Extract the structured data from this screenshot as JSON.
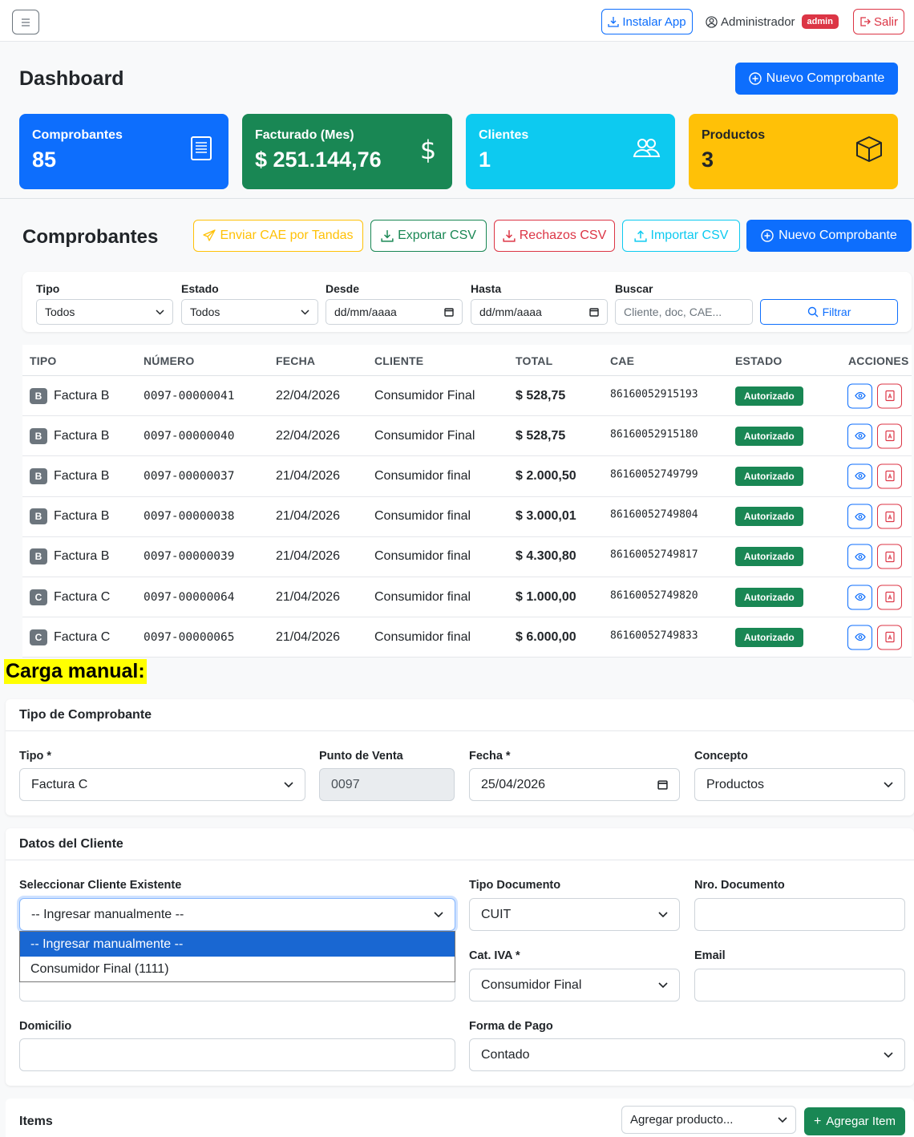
{
  "topbar": {
    "install_label": "Instalar App",
    "user_name": "Administrador",
    "role_badge": "admin",
    "logout_label": "Salir"
  },
  "dashboard": {
    "title": "Dashboard",
    "new_button": "Nuevo Comprobante",
    "stats": [
      {
        "label": "Comprobantes",
        "value": "85",
        "icon": "receipt-icon",
        "color": "#0d6efd"
      },
      {
        "label": "Facturado (Mes)",
        "value": "$ 251.144,76",
        "icon": "dollar-icon",
        "color": "#198754"
      },
      {
        "label": "Clientes",
        "value": "1",
        "icon": "people-icon",
        "color": "#0dcaf0"
      },
      {
        "label": "Productos",
        "value": "3",
        "icon": "box-icon",
        "color": "#ffc107"
      }
    ]
  },
  "comprobantes": {
    "title": "Comprobantes",
    "actions": {
      "send_cae": "Enviar CAE por Tandas",
      "export_csv": "Exportar CSV",
      "rejects_csv": "Rechazos CSV",
      "import_csv": "Importar CSV",
      "new": "Nuevo Comprobante"
    },
    "filters": {
      "tipo_label": "Tipo",
      "tipo_value": "Todos",
      "estado_label": "Estado",
      "estado_value": "Todos",
      "desde_label": "Desde",
      "desde_value": "dd/mm/aaaa",
      "hasta_label": "Hasta",
      "hasta_value": "dd/mm/aaaa",
      "buscar_label": "Buscar",
      "buscar_placeholder": "Cliente, doc, CAE...",
      "filter_button": "Filtrar"
    },
    "columns": [
      "TIPO",
      "NÚMERO",
      "FECHA",
      "CLIENTE",
      "TOTAL",
      "CAE",
      "ESTADO",
      "ACCIONES"
    ],
    "rows": [
      {
        "letter": "B",
        "tipo": "Factura B",
        "numero": "0097-00000041",
        "fecha": "22/04/2026",
        "cliente": "Consumidor Final",
        "total": "$ 528,75",
        "cae": "86160052915193",
        "estado": "Autorizado"
      },
      {
        "letter": "B",
        "tipo": "Factura B",
        "numero": "0097-00000040",
        "fecha": "22/04/2026",
        "cliente": "Consumidor Final",
        "total": "$ 528,75",
        "cae": "86160052915180",
        "estado": "Autorizado"
      },
      {
        "letter": "B",
        "tipo": "Factura B",
        "numero": "0097-00000037",
        "fecha": "21/04/2026",
        "cliente": "Consumidor final",
        "total": "$ 2.000,50",
        "cae": "86160052749799",
        "estado": "Autorizado"
      },
      {
        "letter": "B",
        "tipo": "Factura B",
        "numero": "0097-00000038",
        "fecha": "21/04/2026",
        "cliente": "Consumidor final",
        "total": "$ 3.000,01",
        "cae": "86160052749804",
        "estado": "Autorizado"
      },
      {
        "letter": "B",
        "tipo": "Factura B",
        "numero": "0097-00000039",
        "fecha": "21/04/2026",
        "cliente": "Consumidor final",
        "total": "$ 4.300,80",
        "cae": "86160052749817",
        "estado": "Autorizado"
      },
      {
        "letter": "C",
        "tipo": "Factura C",
        "numero": "0097-00000064",
        "fecha": "21/04/2026",
        "cliente": "Consumidor final",
        "total": "$ 1.000,00",
        "cae": "86160052749820",
        "estado": "Autorizado"
      },
      {
        "letter": "C",
        "tipo": "Factura C",
        "numero": "0097-00000065",
        "fecha": "21/04/2026",
        "cliente": "Consumidor final",
        "total": "$ 6.000,00",
        "cae": "86160052749833",
        "estado": "Autorizado"
      }
    ]
  },
  "annotation": "Carga manual:",
  "form": {
    "tipo_card": {
      "title": "Tipo de Comprobante",
      "tipo_label": "Tipo *",
      "tipo_value": "Factura C",
      "punto_label": "Punto de Venta",
      "punto_value": "0097",
      "fecha_label": "Fecha *",
      "fecha_value": "25/04/2026",
      "concepto_label": "Concepto",
      "concepto_value": "Productos"
    },
    "cliente_card": {
      "title": "Datos del Cliente",
      "select_label": "Seleccionar Cliente Existente",
      "select_value": "-- Ingresar manualmente --",
      "dropdown_options": [
        "-- Ingresar manualmente --",
        "Consumidor Final (1111)"
      ],
      "tipo_doc_label": "Tipo Documento",
      "tipo_doc_value": "CUIT",
      "nro_doc_label": "Nro. Documento",
      "nro_doc_value": "",
      "cat_iva_label": "Cat. IVA *",
      "cat_iva_value": "Consumidor Final",
      "email_label": "Email",
      "email_value": "",
      "domicilio_label": "Domicilio",
      "domicilio_value": "",
      "forma_pago_label": "Forma de Pago",
      "forma_pago_value": "Contado"
    },
    "items_card": {
      "title": "Items",
      "product_select": "Agregar producto...",
      "add_button": "Agregar Item"
    }
  }
}
